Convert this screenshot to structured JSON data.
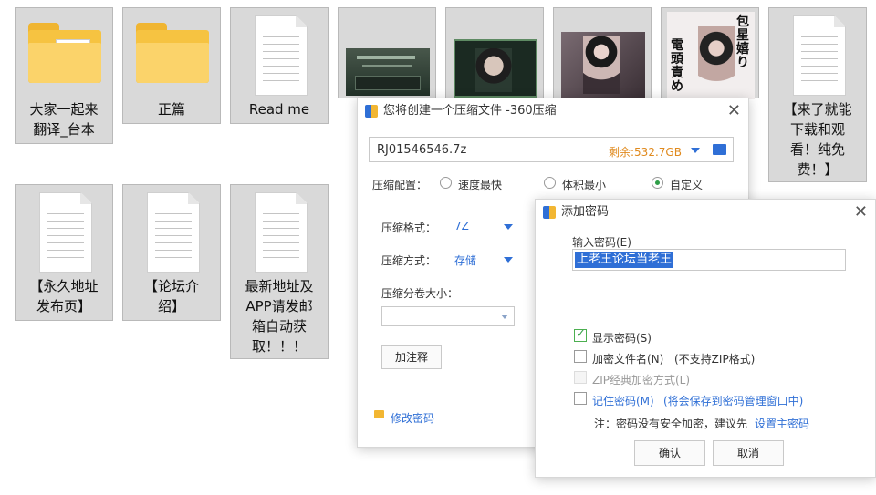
{
  "desktop_files": [
    {
      "label": "大家一起来\n翻译_台本",
      "icon": "folder-icon"
    },
    {
      "label": "正篇",
      "icon": "folder-icon"
    },
    {
      "label": "Read me",
      "icon": "document-icon"
    },
    {
      "label": "",
      "icon": "image-thumbnail-icon"
    },
    {
      "label": "",
      "icon": "image-thumbnail-icon"
    },
    {
      "label": "",
      "icon": "image-thumbnail-icon"
    },
    {
      "label": "",
      "icon": "image-thumbnail-icon",
      "thumb_text_right": "包星嬉り",
      "thumb_text_left": "電頭責め"
    },
    {
      "label": "【来了就能\n下载和观\n看！纯免\n费！】",
      "icon": "document-icon"
    },
    {
      "label": "【永久地址\n发布页】",
      "icon": "document-icon"
    },
    {
      "label": "【论坛介\n绍】",
      "icon": "document-icon"
    },
    {
      "label": "最新地址及\nAPP请发邮\n箱自动获\n取！！！",
      "icon": "document-icon"
    }
  ],
  "compress_dialog": {
    "title": "您将创建一个压缩文件 -360压缩",
    "filename": "RJ01546546.7z",
    "free_space": "剩余:532.7GB",
    "config_label": "压缩配置：",
    "options": [
      "速度最快",
      "体积最小",
      "自定义"
    ],
    "selected_option": "自定义",
    "format_label": "压缩格式：",
    "format_value": "7Z",
    "method_label": "压缩方式：",
    "method_value": "存储",
    "split_label": "压缩分卷大小：",
    "split_value": "",
    "comment_button": "加注释",
    "password_link": "修改密码"
  },
  "password_dialog": {
    "title": "添加密码",
    "input_label": "输入密码(E)",
    "password_value": "上老王论坛当老王",
    "show_password": "显示密码(S)",
    "show_password_checked": true,
    "encrypt_names": "加密文件名(N)",
    "encrypt_names_note": "(不支持ZIP格式)",
    "encrypt_names_checked": false,
    "zip_classic": "ZIP经典加密方式(L)",
    "zip_classic_disabled": true,
    "remember": "记住密码(M)",
    "remember_note": "(将会保存到密码管理窗口中)",
    "remember_checked": false,
    "note_prefix": "注：密码没有安全加密，建议先",
    "note_link": "设置主密码",
    "ok": "确认",
    "cancel": "取消"
  },
  "colors": {
    "accent_blue": "#2f6fd6",
    "free_space_orange": "#e08a1e",
    "check_green": "#3aa24a",
    "selection_blue": "#2f6fd6"
  }
}
